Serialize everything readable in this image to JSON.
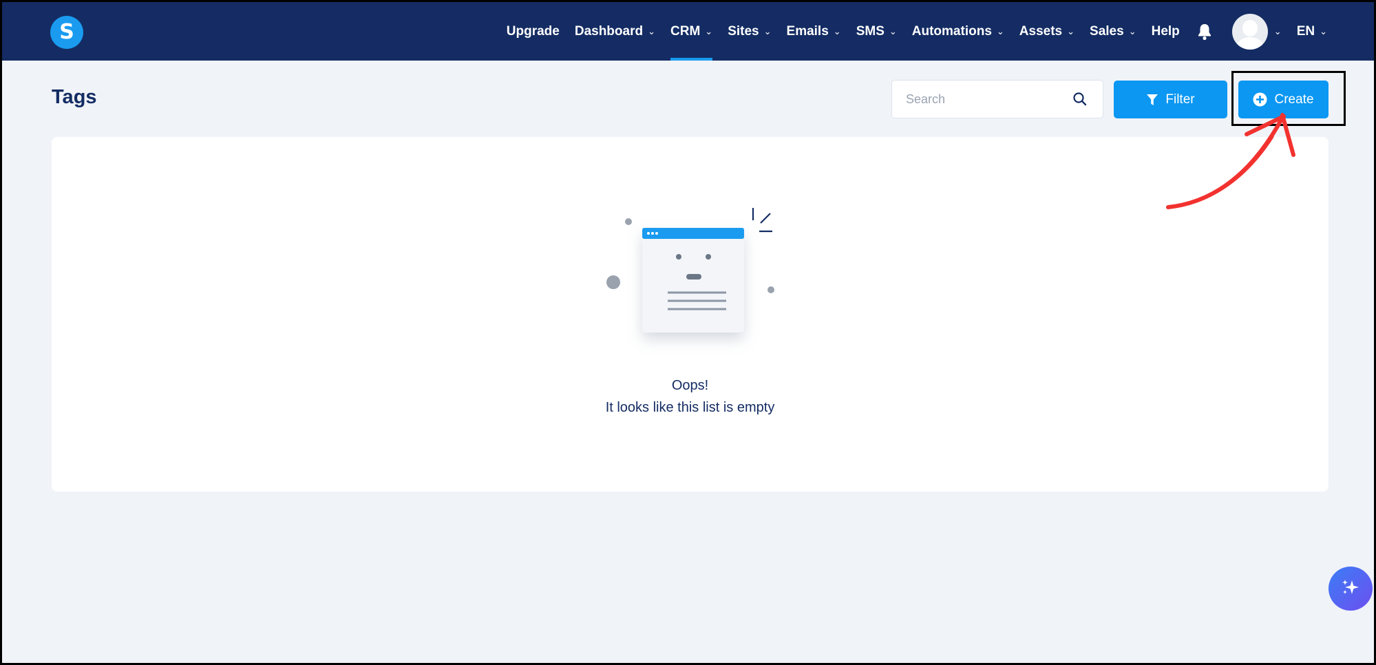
{
  "app": {
    "logo_letter": "S"
  },
  "nav": {
    "items": [
      {
        "label": "Upgrade",
        "dropdown": false
      },
      {
        "label": "Dashboard",
        "dropdown": true
      },
      {
        "label": "CRM",
        "dropdown": true,
        "active": true
      },
      {
        "label": "Sites",
        "dropdown": true
      },
      {
        "label": "Emails",
        "dropdown": true
      },
      {
        "label": "SMS",
        "dropdown": true
      },
      {
        "label": "Automations",
        "dropdown": true
      },
      {
        "label": "Assets",
        "dropdown": true
      },
      {
        "label": "Sales",
        "dropdown": true
      },
      {
        "label": "Help",
        "dropdown": false
      }
    ],
    "language": "EN"
  },
  "page": {
    "title": "Tags",
    "search_placeholder": "Search",
    "filter_label": "Filter",
    "create_label": "Create"
  },
  "empty_state": {
    "title": "Oops!",
    "subtitle": "It looks like this list is empty"
  },
  "colors": {
    "nav_bg": "#142c63",
    "accent": "#0b97f2",
    "page_bg": "#f0f3f8",
    "annotation": "#f2322f"
  }
}
